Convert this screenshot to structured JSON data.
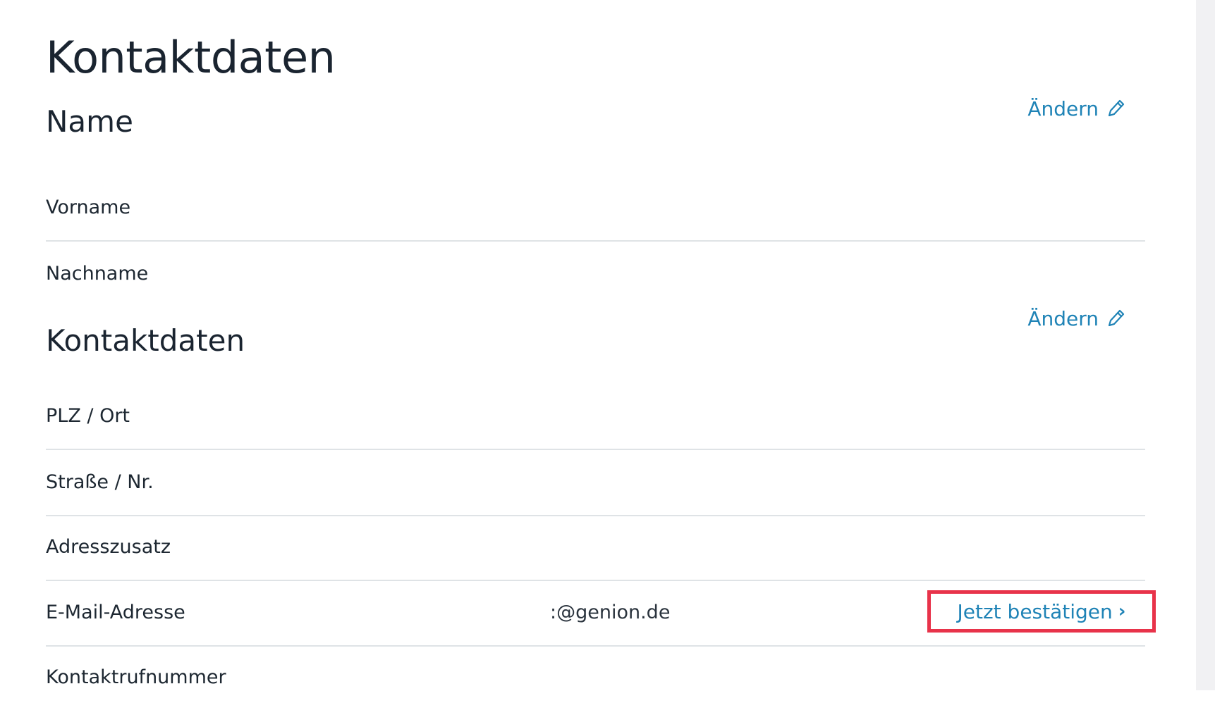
{
  "page": {
    "title": "Kontaktdaten"
  },
  "name_section": {
    "title": "Name",
    "edit_label": "Ändern",
    "rows": [
      {
        "label": "Vorname",
        "value": ""
      },
      {
        "label": "Nachname",
        "value": ""
      }
    ]
  },
  "contact_section": {
    "title": "Kontaktdaten",
    "edit_label": "Ändern",
    "rows": [
      {
        "label": "PLZ / Ort",
        "value": ""
      },
      {
        "label": "Straße / Nr.",
        "value": ""
      },
      {
        "label": "Adresszusatz",
        "value": ""
      },
      {
        "label": "E-Mail-Adresse",
        "value": ":@genion.de",
        "action_label": "Jetzt bestätigen"
      },
      {
        "label": "Kontaktrufnummer",
        "value": ""
      }
    ]
  },
  "colors": {
    "accent": "#1f83b6",
    "highlight_border": "#e8334a",
    "divider": "#dfe3e6",
    "text": "#1d2731"
  },
  "icons": {
    "edit": "pencil-icon",
    "confirm": "chevron-right-icon"
  }
}
